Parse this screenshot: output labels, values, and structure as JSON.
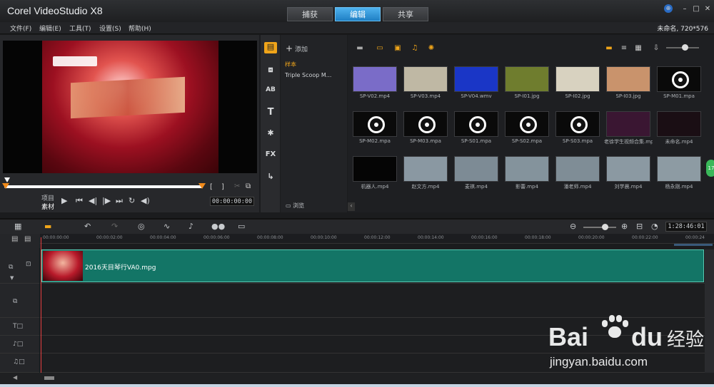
{
  "app": {
    "title": "Corel VideoStudio X8",
    "project_info": "未命名, 720*576"
  },
  "tabs": [
    {
      "label": "捕获"
    },
    {
      "label": "编辑"
    },
    {
      "label": "共享"
    }
  ],
  "menu": [
    {
      "label": "文件(F)"
    },
    {
      "label": "编辑(E)"
    },
    {
      "label": "工具(T)"
    },
    {
      "label": "设置(S)"
    },
    {
      "label": "帮助(H)"
    }
  ],
  "preview": {
    "mode_project": "项目",
    "mode_clip": "素材",
    "timecode": "00:00:00:00",
    "scrub_progress": 1.0
  },
  "library": {
    "add_label": "添加",
    "browse_label": "浏览",
    "folders": [
      {
        "label": "样本"
      },
      {
        "label": "Triple Scoop M..."
      }
    ],
    "options_label": "选项",
    "media": [
      {
        "name": "SP-V02.mp4",
        "color": "#7a6cc8"
      },
      {
        "name": "SP-V03.mp4",
        "color": "#bfb8a4"
      },
      {
        "name": "SP-V04.wmv",
        "color": "#1a36c6"
      },
      {
        "name": "SP-I01.jpg",
        "color": "#6f7d2e"
      },
      {
        "name": "SP-I02.jpg",
        "color": "#d8d2c0"
      },
      {
        "name": "SP-I03.jpg",
        "color": "#c9936c"
      },
      {
        "name": "SP-M01.mpa",
        "color": "#0a0a0a"
      },
      {
        "name": "SP-M02.mpa",
        "color": "#0a0a0a"
      },
      {
        "name": "SP-M03.mpa",
        "color": "#0a0a0a"
      },
      {
        "name": "SP-S01.mpa",
        "color": "#0a0a0a"
      },
      {
        "name": "SP-S02.mpa",
        "color": "#0a0a0a"
      },
      {
        "name": "SP-S03.mpa",
        "color": "#0a0a0a"
      },
      {
        "name": "老徐学生视频合集.mp4",
        "color": "#3a1632"
      },
      {
        "name": "未命名.mp4",
        "color": "#1a0e14"
      },
      {
        "name": "机器人.mp4",
        "color": "#050505"
      },
      {
        "name": "赵文方.mp4",
        "color": "#8a98a2"
      },
      {
        "name": "麦祺.mp4",
        "color": "#7d8b95"
      },
      {
        "name": "影蕾.mp4",
        "color": "#84939c"
      },
      {
        "name": "潘老师.mp4",
        "color": "#7f8d96"
      },
      {
        "name": "刘学晨.mp4",
        "color": "#8b99a2"
      },
      {
        "name": "杨永刚.mp4",
        "color": "#8d9ba3"
      }
    ]
  },
  "timeline": {
    "timecode": "1:28:46:01",
    "ruler": [
      "00:00:00:00",
      "00:00:02:00",
      "00:00:04:00",
      "00:00:06:00",
      "00:00:08:00",
      "00:00:10:00",
      "00:00:12:00",
      "00:00:14:00",
      "00:00:16:00",
      "00:00:18:00",
      "00:00:20:00",
      "00:00:22:00",
      "00:00:24"
    ],
    "clip_name": "2016天目琴行VA0.mpg"
  },
  "watermark": {
    "brand": "Bai",
    "brand2": "du",
    "cn": "经验",
    "url": "jingyan.baidu.com"
  },
  "colors": {
    "accent": "#1f7fc4",
    "orange": "#f0a51a",
    "clip": "#137566"
  }
}
